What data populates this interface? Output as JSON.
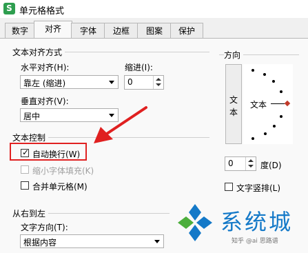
{
  "window": {
    "title": "单元格格式",
    "app_icon_letter": "S"
  },
  "tabs": [
    {
      "label": "数字",
      "active": false
    },
    {
      "label": "对齐",
      "active": true
    },
    {
      "label": "字体",
      "active": false
    },
    {
      "label": "边框",
      "active": false
    },
    {
      "label": "图案",
      "active": false
    },
    {
      "label": "保护",
      "active": false
    }
  ],
  "text_alignment": {
    "group_title": "文本对齐方式",
    "horizontal_label": "水平对齐(H):",
    "horizontal_value": "靠左 (缩进)",
    "indent_label": "缩进(I):",
    "indent_value": "0",
    "vertical_label": "垂直对齐(V):",
    "vertical_value": "居中"
  },
  "text_control": {
    "group_title": "文本控制",
    "wrap_text": {
      "label": "自动换行(W)",
      "checked": true
    },
    "shrink_to_fit": {
      "label": "缩小字体填充(K)",
      "checked": false,
      "disabled": true
    },
    "merge_cells": {
      "label": "合并单元格(M)",
      "checked": false
    }
  },
  "rtl": {
    "group_title": "从右到左",
    "direction_label": "文字方向(T):",
    "direction_value": "根据内容"
  },
  "orientation": {
    "group_title": "方向",
    "vertical_text_button": [
      "文",
      "本"
    ],
    "dial_text": "文本",
    "degrees_value": "0",
    "degrees_label": "度(D)",
    "vertical_stack": {
      "label": "文字竖排(L)",
      "checked": false
    }
  },
  "annotation": {
    "color": "#e02020"
  },
  "watermark": {
    "main": "系统城",
    "sub": "知乎 @ai 思路谱",
    "colors": {
      "blue": "#1479c8",
      "green": "#4cae3c"
    }
  }
}
